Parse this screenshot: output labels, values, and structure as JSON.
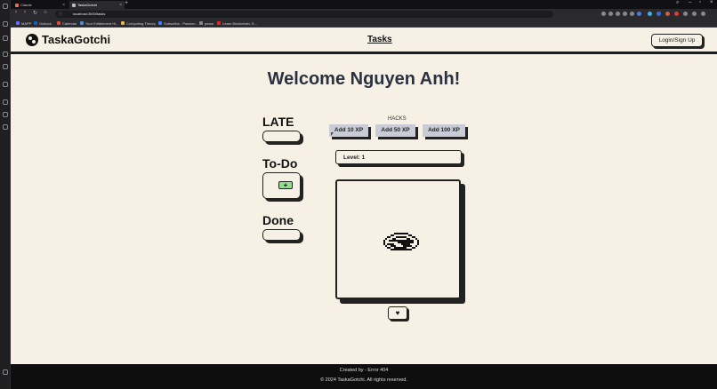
{
  "browser": {
    "tabs": [
      {
        "label": "Claude",
        "fav_color": "#d97757",
        "active": false
      },
      {
        "label": "TaskaGotchi",
        "fav_color": "#bbbbbb",
        "active": true
      }
    ],
    "new_tab": "+",
    "url": "localhost:3000/tasks",
    "bookmarks": [
      {
        "label": "MAPP",
        "color": "#6b6bff"
      },
      {
        "label": "Outlook",
        "color": "#0a64c8"
      },
      {
        "label": "Calendar",
        "color": "#e04a3a"
      },
      {
        "label": "Your Entitlement Hi...",
        "color": "#4a90e2"
      },
      {
        "label": "Computing Theory",
        "color": "#e6b84a"
      },
      {
        "label": "Subscribe - Passion...",
        "color": "#3b82f6"
      },
      {
        "label": "pears",
        "color": "#888888"
      },
      {
        "label": "Learn Blockchain, S...",
        "color": "#e02a2a"
      }
    ]
  },
  "nav": {
    "logo_text": "TaskaGotchi",
    "tasks_link": "Tasks",
    "login_label": "Login/Sign Up"
  },
  "welcome": "Welcome Nguyen Anh!",
  "sections": {
    "late": "LATE",
    "todo": "To-Do",
    "todo_add": "+",
    "done": "Done"
  },
  "hacks": {
    "label": "HACKS",
    "buttons": [
      "Add 10 XP",
      "Add 50 XP",
      "Add 100 XP"
    ]
  },
  "level": "Level: 1",
  "feed_icon": "heart-icon",
  "footer": {
    "created_by": "Created by - Error 404",
    "copyright": "© 2024 TaskaGotchi. All rights reserved."
  }
}
